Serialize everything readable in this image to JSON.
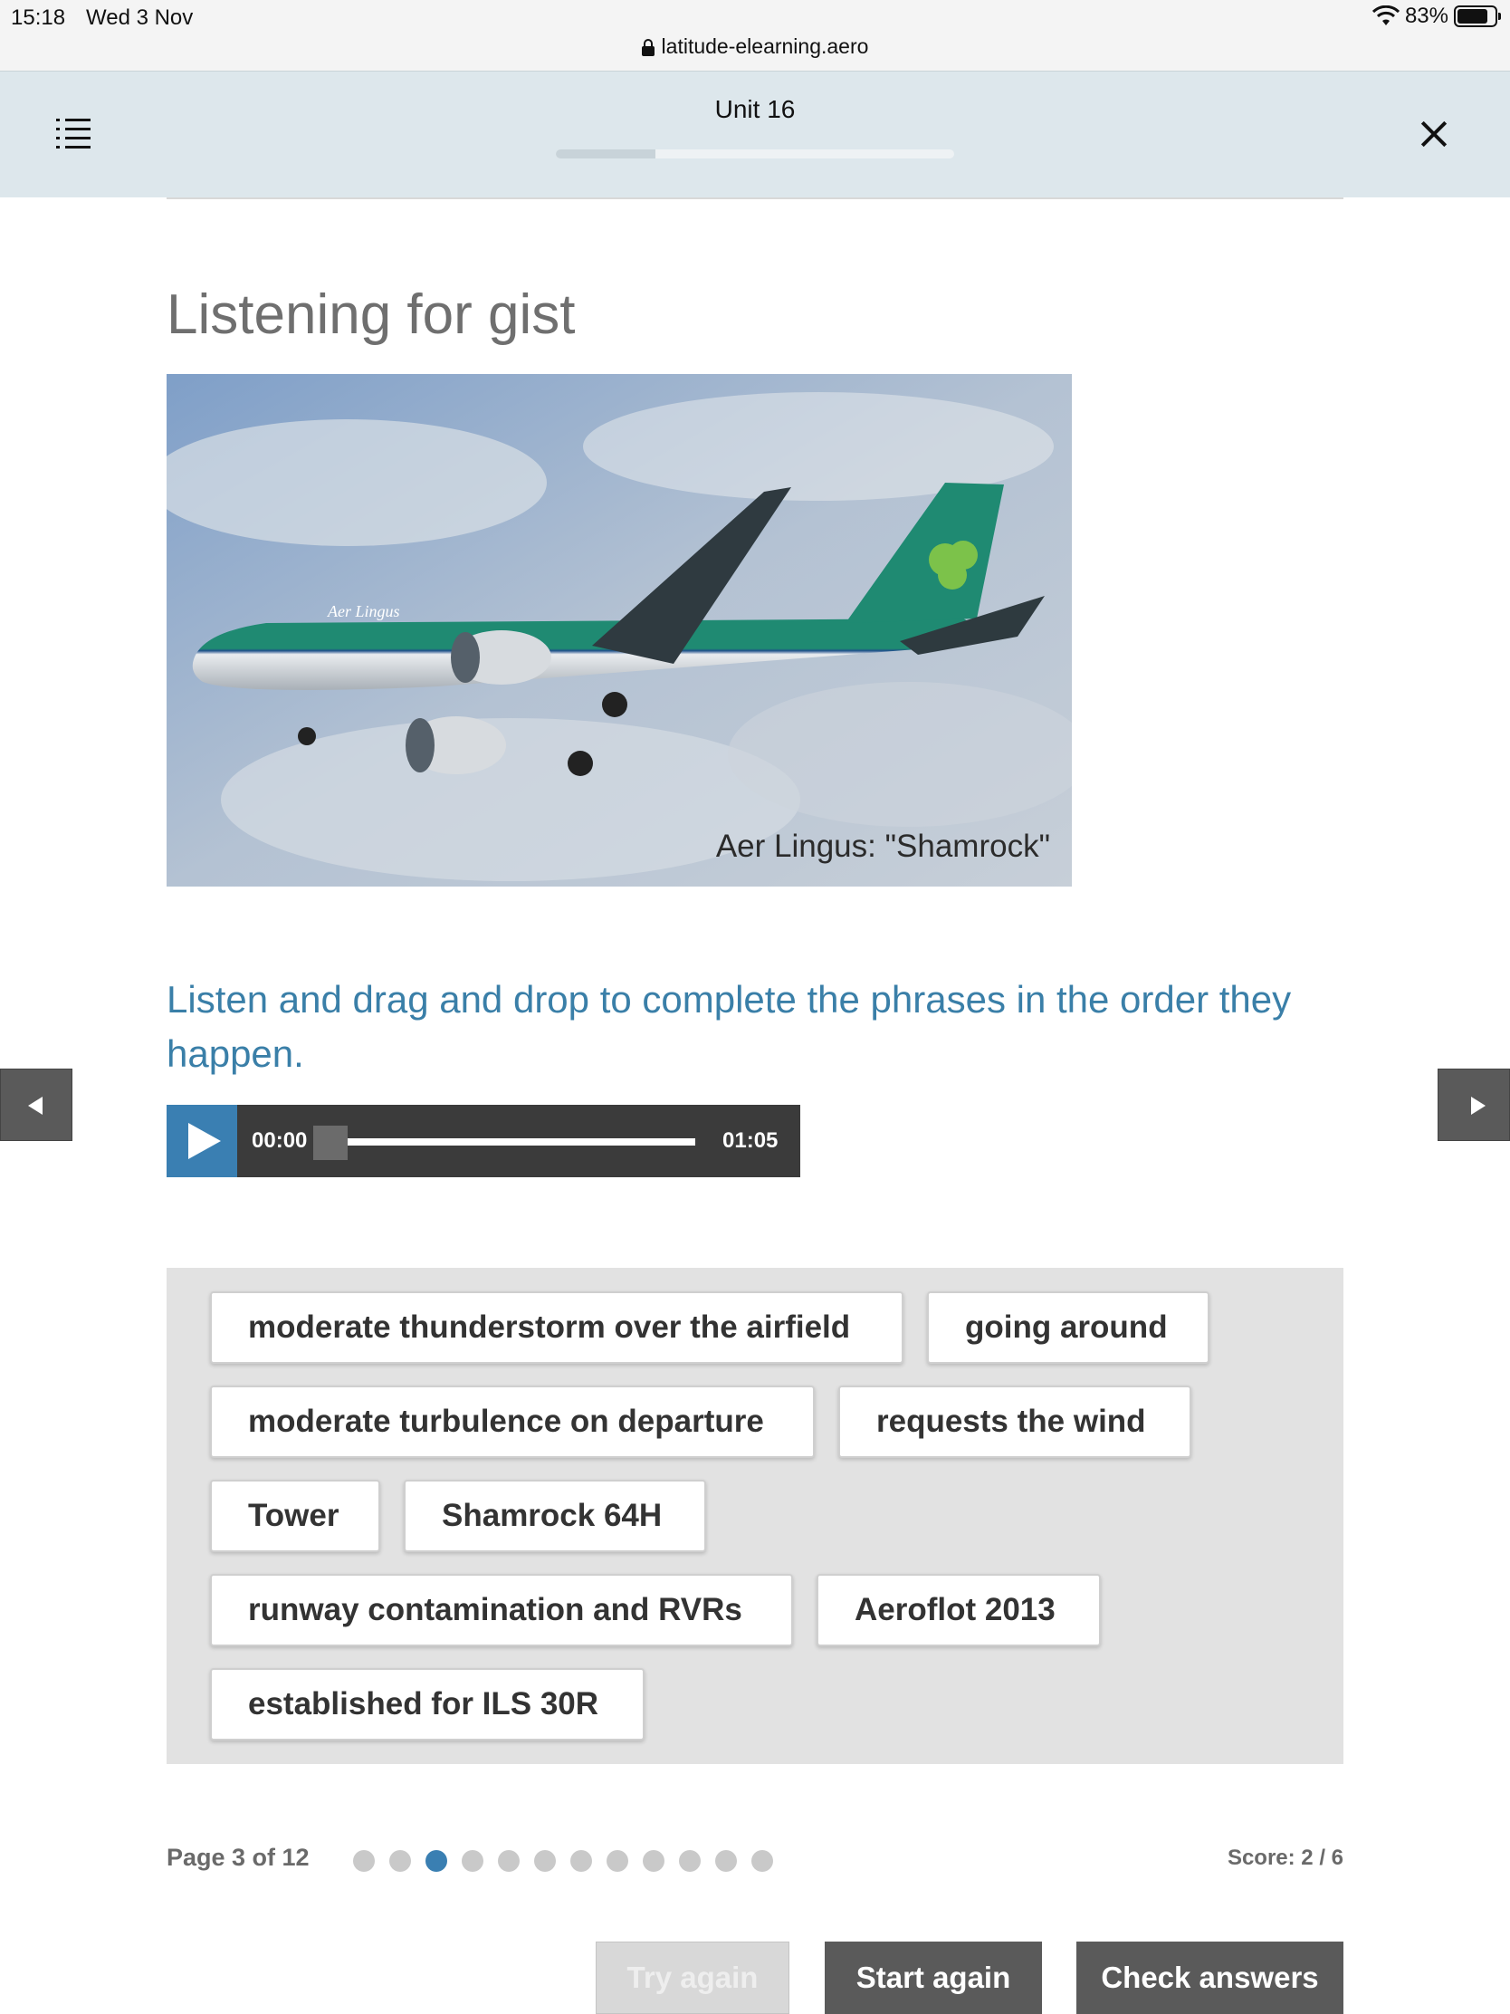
{
  "status_bar": {
    "time": "15:18",
    "date": "Wed 3 Nov",
    "battery": "83%",
    "battery_level": 0.83,
    "url": "latitude-elearning.aero"
  },
  "header": {
    "title": "Unit 16",
    "progress": 0.25
  },
  "page": {
    "heading": "Listening for gist",
    "image_caption": "Aer Lingus: \"Shamrock\"",
    "instruction": "Listen and drag and drop to complete the phrases in the order they happen."
  },
  "audio": {
    "current_time": "00:00",
    "total_time": "01:05"
  },
  "tokens": [
    "moderate thunderstorm over the airfield",
    "going around",
    "moderate turbulence on departure",
    "requests the wind",
    "Tower",
    "Shamrock 64H",
    "runway contamination and RVRs",
    "Aeroflot 2013",
    "established for ILS 30R"
  ],
  "pagination": {
    "label": "Page 3 of 12",
    "total": 12,
    "current": 3
  },
  "score": "Score: 2 / 6",
  "buttons": {
    "try_again": "Try again",
    "start_again": "Start again",
    "check_answers": "Check answers"
  },
  "colors": {
    "accent": "#3a7fb2",
    "header_bg": "#dde7ec",
    "button_dark": "#5a5a5a",
    "token_area_bg": "#e2e2e2"
  }
}
